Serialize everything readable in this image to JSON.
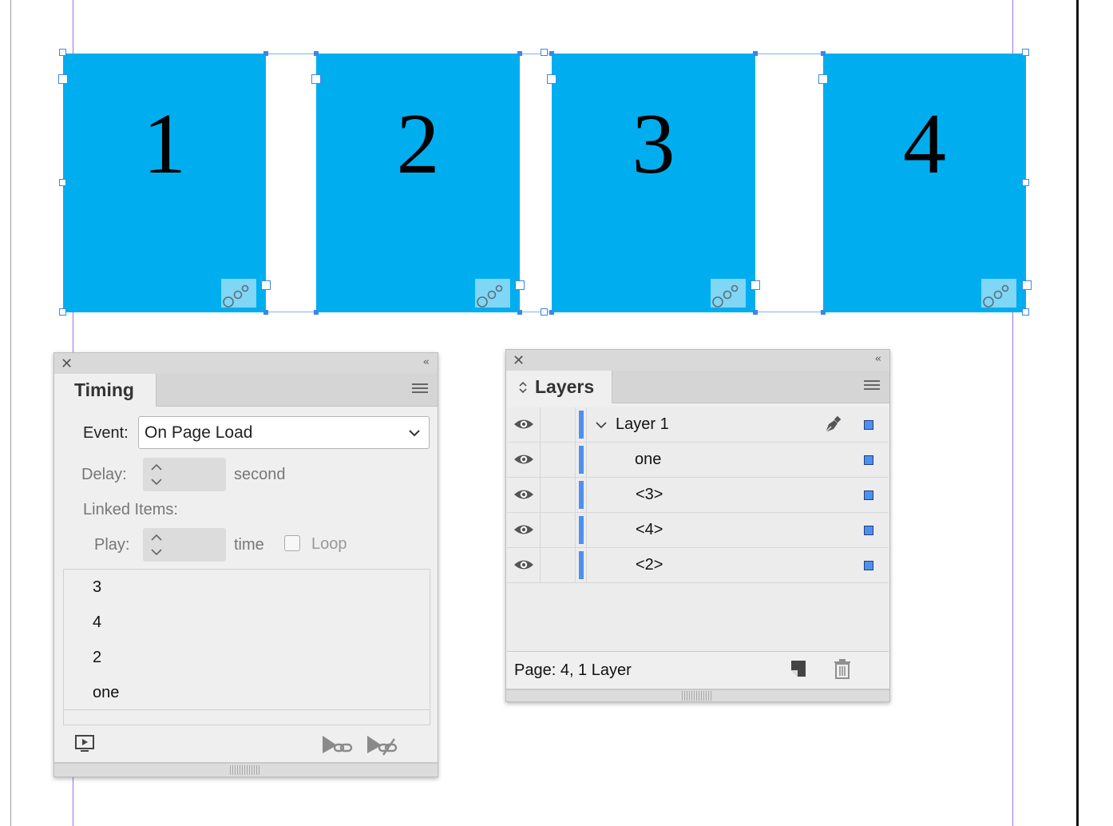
{
  "canvas": {
    "boxes": [
      {
        "number": "1"
      },
      {
        "number": "2"
      },
      {
        "number": "3"
      },
      {
        "number": "4"
      }
    ],
    "box_color": "#00aeef",
    "selection_color": "#3d86e8",
    "guide_color": "#8a3fd1"
  },
  "timing_panel": {
    "tab_label": "Timing",
    "event_label": "Event:",
    "event_value": "On Page Load",
    "delay_label": "Delay:",
    "delay_unit": "second",
    "linked_items_label": "Linked Items:",
    "play_label": "Play:",
    "play_unit": "time",
    "loop_label": "Loop",
    "loop_checked": false,
    "items": [
      "3",
      "4",
      "2",
      "one"
    ],
    "footer_icons": [
      "preview-icon",
      "link-items-icon",
      "unlink-items-icon"
    ]
  },
  "layers_panel": {
    "tab_label": "Layers",
    "layers": [
      {
        "name": "Layer 1",
        "expanded": true,
        "visible": true,
        "top_level": true
      },
      {
        "name": "one",
        "visible": true,
        "top_level": false
      },
      {
        "name": "<3>",
        "visible": true,
        "top_level": false
      },
      {
        "name": "<4>",
        "visible": true,
        "top_level": false
      },
      {
        "name": "<2>",
        "visible": true,
        "top_level": false
      }
    ],
    "status_text": "Page: 4, 1 Layer",
    "footer_icons": [
      "new-layer-icon",
      "trash-icon"
    ],
    "layer_color": "#4f8ff0"
  }
}
